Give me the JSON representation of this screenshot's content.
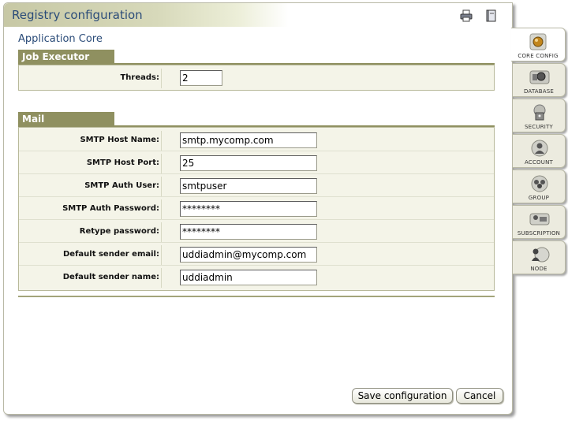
{
  "header": {
    "title": "Registry configuration",
    "print_icon": "printer-icon",
    "help_icon": "help-book-icon"
  },
  "section": {
    "title": "Application Core"
  },
  "job_executor": {
    "title": "Job Executor",
    "fields": [
      {
        "label": "Threads:",
        "value": "2"
      }
    ]
  },
  "mail": {
    "title": "Mail",
    "fields": [
      {
        "label": "SMTP Host Name:",
        "value": "smtp.mycomp.com"
      },
      {
        "label": "SMTP Host Port:",
        "value": "25"
      },
      {
        "label": "SMTP Auth User:",
        "value": "smtpuser"
      },
      {
        "label": "SMTP Auth Password:",
        "value": "********"
      },
      {
        "label": "Retype password:",
        "value": "********"
      },
      {
        "label": "Default sender email:",
        "value": "uddiadmin@mycomp.com"
      },
      {
        "label": "Default sender name:",
        "value": "uddiadmin"
      }
    ]
  },
  "buttons": {
    "save": "Save configuration",
    "cancel": "Cancel"
  },
  "tabs": [
    {
      "label": "CORE CONFIG",
      "icon": "core-config-icon",
      "active": true
    },
    {
      "label": "DATABASE",
      "icon": "database-icon",
      "active": false
    },
    {
      "label": "SECURITY",
      "icon": "security-icon",
      "active": false
    },
    {
      "label": "ACCOUNT",
      "icon": "account-icon",
      "active": false
    },
    {
      "label": "GROUP",
      "icon": "group-icon",
      "active": false
    },
    {
      "label": "SUBSCRIPTION",
      "icon": "subscription-icon",
      "active": false
    },
    {
      "label": "NODE",
      "icon": "node-icon",
      "active": false
    }
  ],
  "colors": {
    "title": "#2b4c79",
    "group_header": "#8f9060",
    "panel_bg": "#f4f4e8"
  }
}
